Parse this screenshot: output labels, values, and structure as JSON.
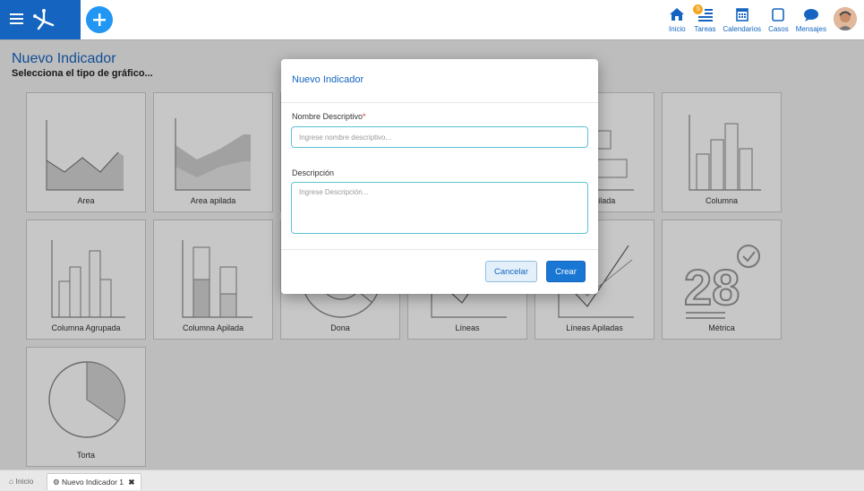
{
  "topbar": {
    "nav": [
      {
        "label": "Inicio",
        "icon": "home-icon"
      },
      {
        "label": "Tareas",
        "icon": "tasks-icon",
        "badge": "5"
      },
      {
        "label": "Calendarios",
        "icon": "calendar-icon"
      },
      {
        "label": "Casos",
        "icon": "cases-icon"
      },
      {
        "label": "Mensajes",
        "icon": "messages-icon"
      }
    ]
  },
  "page": {
    "title": "Nuevo Indicador",
    "subtitle": "Selecciona el tipo de gráfico..."
  },
  "tiles": [
    {
      "label": "Area"
    },
    {
      "label": "Area apilada"
    },
    {
      "label": ""
    },
    {
      "label": ""
    },
    {
      "label": "ntal Apilada"
    },
    {
      "label": "Columna"
    },
    {
      "label": "Columna Agrupada"
    },
    {
      "label": "Columna Apilada"
    },
    {
      "label": "Dona"
    },
    {
      "label": "Líneas"
    },
    {
      "label": "Líneas Apiladas"
    },
    {
      "label": "Métrica"
    },
    {
      "label": "Torta"
    }
  ],
  "metric_number": "28",
  "modal": {
    "title": "Nuevo Indicador",
    "name_label": "Nombre Descriptivo",
    "name_required_mark": "*",
    "name_placeholder": "Ingrese nombre descriptivo...",
    "desc_label": "Descripción",
    "desc_placeholder": "Ingrese Descripción...",
    "cancel_label": "Cancelar",
    "create_label": "Crear"
  },
  "footer": {
    "tabs": [
      {
        "label": "Inicio"
      },
      {
        "label": "Nuevo Indicador 1"
      }
    ]
  },
  "colors": {
    "brand": "#1565c0",
    "accent": "#2196f3",
    "input_border": "#5cc3d6",
    "badge": "#f5a623"
  }
}
